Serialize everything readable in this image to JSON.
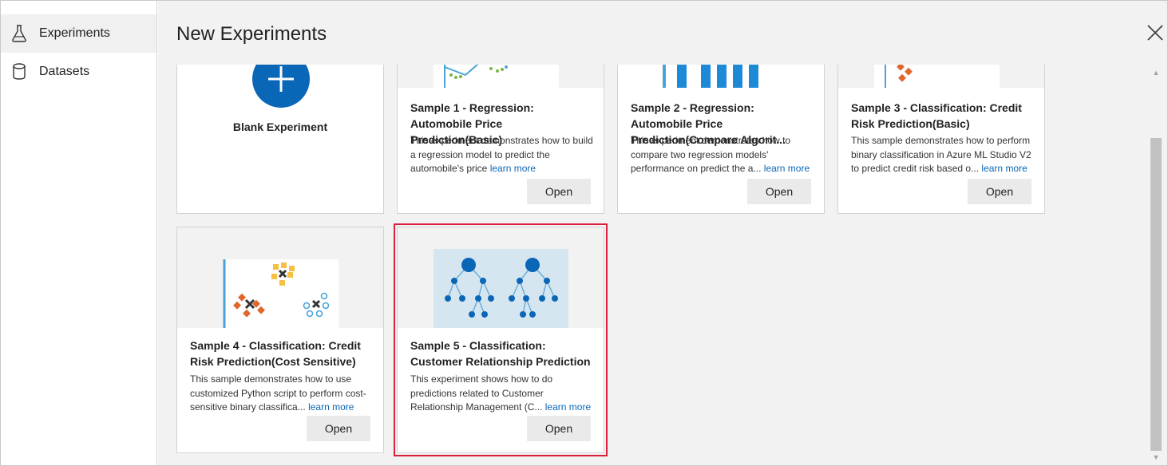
{
  "sidebar": {
    "items": [
      {
        "label": "Experiments",
        "icon": "flask-icon",
        "active": true
      },
      {
        "label": "Datasets",
        "icon": "database-icon",
        "active": false
      }
    ]
  },
  "header": {
    "title": "New Experiments"
  },
  "blank": {
    "label": "Blank Experiment"
  },
  "cards": [
    {
      "title": "Sample 1 - Regression: Automobile Price Prediction(Basic)",
      "desc": "This experiment demonstrates how to build a regression model to predict the automobile's price",
      "learn": "learn more",
      "open": "Open"
    },
    {
      "title": "Sample 2 - Regression: Automobile Price Prediction(Compare Algorit...",
      "desc": "This experiment demonstrates how to compare two regression models' performance on predict the a...",
      "learn": "learn more",
      "open": "Open"
    },
    {
      "title": "Sample 3 - Classification: Credit Risk Prediction(Basic)",
      "desc": "This sample demonstrates how to perform binary classification in Azure ML Studio V2 to predict credit risk based o...",
      "learn": "learn more",
      "open": "Open"
    },
    {
      "title": "Sample 4 - Classification: Credit Risk Prediction(Cost Sensitive)",
      "desc": "This sample demonstrates how to use customized Python script to perform cost-sensitive binary classifica...",
      "learn": "learn more",
      "open": "Open"
    },
    {
      "title": "Sample 5 - Classification: Customer Relationship Prediction",
      "desc": "This experiment shows how to do predictions related to Customer Relationship Management (C...",
      "learn": "learn more",
      "open": "Open"
    }
  ],
  "colors": {
    "accent": "#0a66b7",
    "highlight": "#dc1f3c",
    "panel_blue": "#d6e6f0",
    "orange": "#e0662a",
    "yellow": "#f5c043"
  }
}
